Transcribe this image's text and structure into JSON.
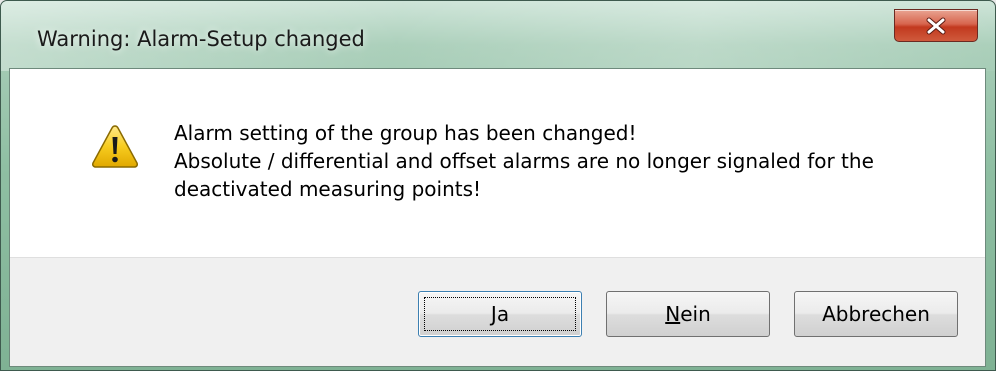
{
  "window": {
    "title": "Warning: Alarm-Setup changed",
    "close_icon": "close-icon"
  },
  "message": {
    "icon": "warning-icon",
    "lines": [
      "Alarm setting of the group has been changed!",
      "Absolute / differential and offset alarms are no longer signaled for the",
      "deactivated measuring points!"
    ]
  },
  "buttons": {
    "ja": {
      "mnemonic": "J",
      "rest": "a"
    },
    "nein": {
      "mnemonic": "N",
      "rest": "ein"
    },
    "abbrechen": {
      "label": "Abbrechen"
    }
  },
  "colors": {
    "titlebar": "#8fbfa3",
    "close_button": "#c2391f",
    "warning_fill": "#f5c400"
  }
}
